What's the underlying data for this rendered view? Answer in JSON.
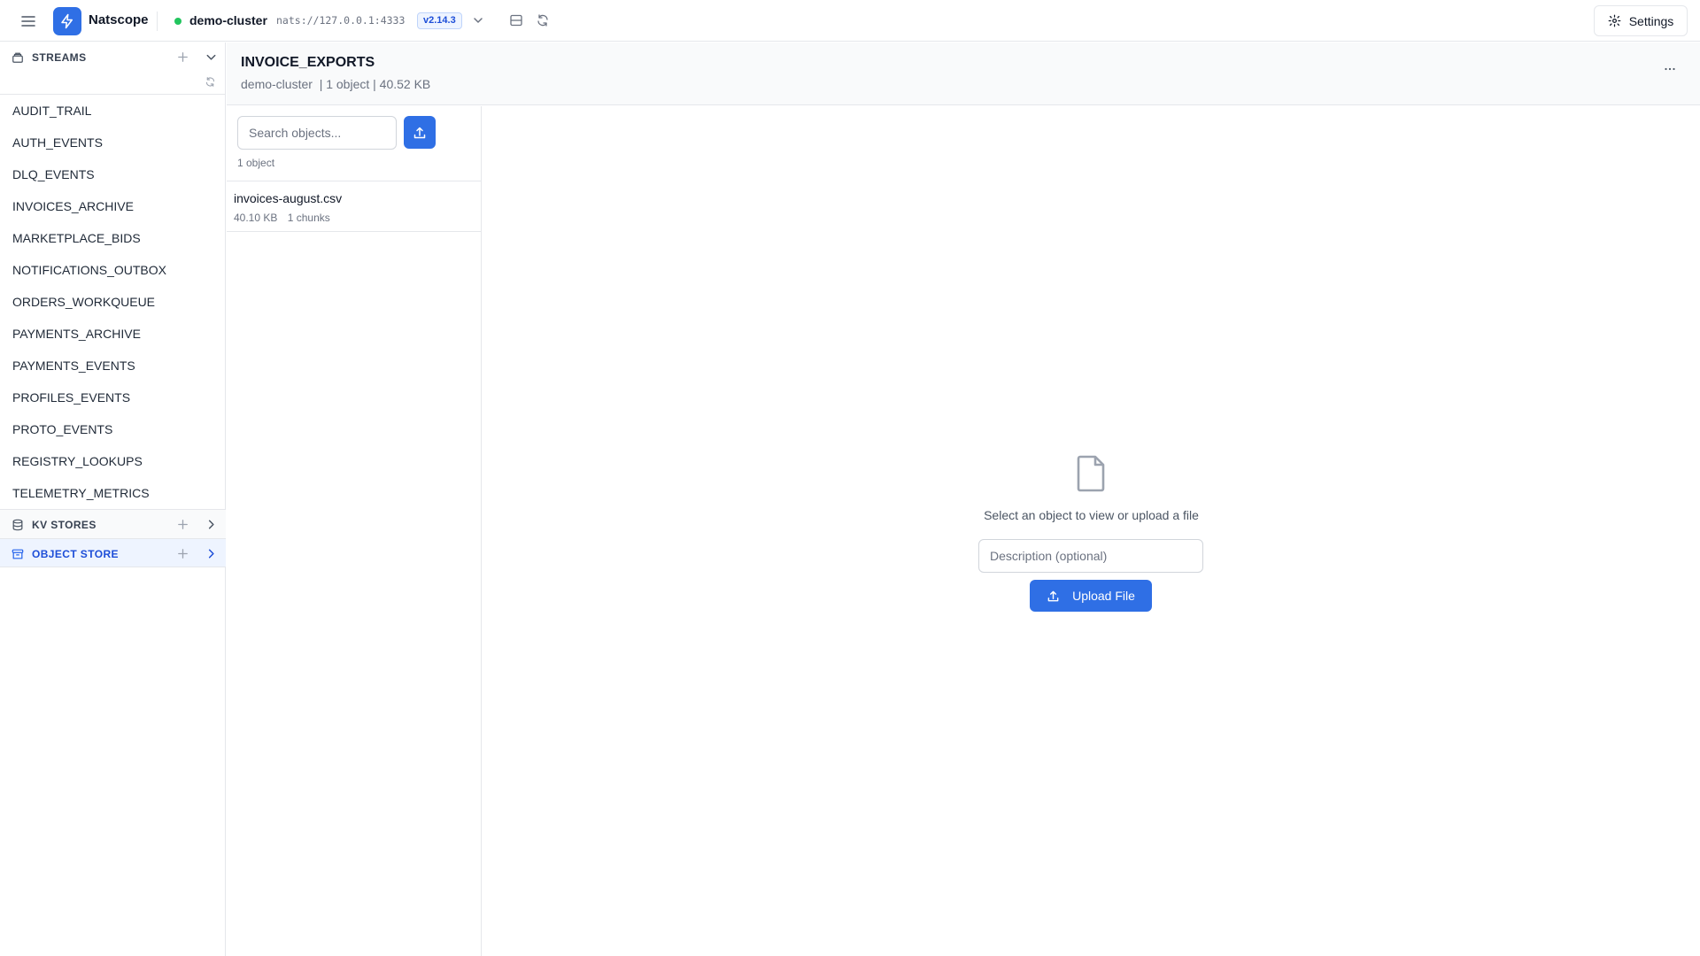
{
  "header": {
    "app_name": "Natscope",
    "cluster_name": "demo-cluster",
    "cluster_url": "nats://127.0.0.1:4333",
    "version": "v2.14.3",
    "settings_label": "Settings",
    "status_color": "#22c55e",
    "accent_color": "#2f6fe5"
  },
  "sidebar": {
    "streams_label": "STREAMS",
    "streams": [
      "AUDIT_TRAIL",
      "AUTH_EVENTS",
      "DLQ_EVENTS",
      "INVOICES_ARCHIVE",
      "MARKETPLACE_BIDS",
      "NOTIFICATIONS_OUTBOX",
      "ORDERS_WORKQUEUE",
      "PAYMENTS_ARCHIVE",
      "PAYMENTS_EVENTS",
      "PROFILES_EVENTS",
      "PROTO_EVENTS",
      "REGISTRY_LOOKUPS",
      "TELEMETRY_METRICS"
    ],
    "kv_label": "KV STORES",
    "object_store_label": "OBJECT STORE"
  },
  "store": {
    "title": "INVOICE_EXPORTS",
    "meta": "demo-cluster  | 1 object | 40.52 KB"
  },
  "objects_panel": {
    "search_placeholder": "Search objects...",
    "count_text": "1 object",
    "items": [
      {
        "name": "invoices-august.csv",
        "size": "40.10 KB",
        "chunks": "1 chunks"
      }
    ]
  },
  "detail": {
    "empty_text": "Select an object to view or upload a file",
    "description_placeholder": "Description (optional)",
    "upload_label": "Upload File"
  },
  "icons": {
    "menu": "menu-icon",
    "logo": "bolt-icon",
    "streams": "stream-icon",
    "kv": "database-icon",
    "object_store": "archive-icon",
    "upload": "upload-icon",
    "file": "file-icon"
  }
}
